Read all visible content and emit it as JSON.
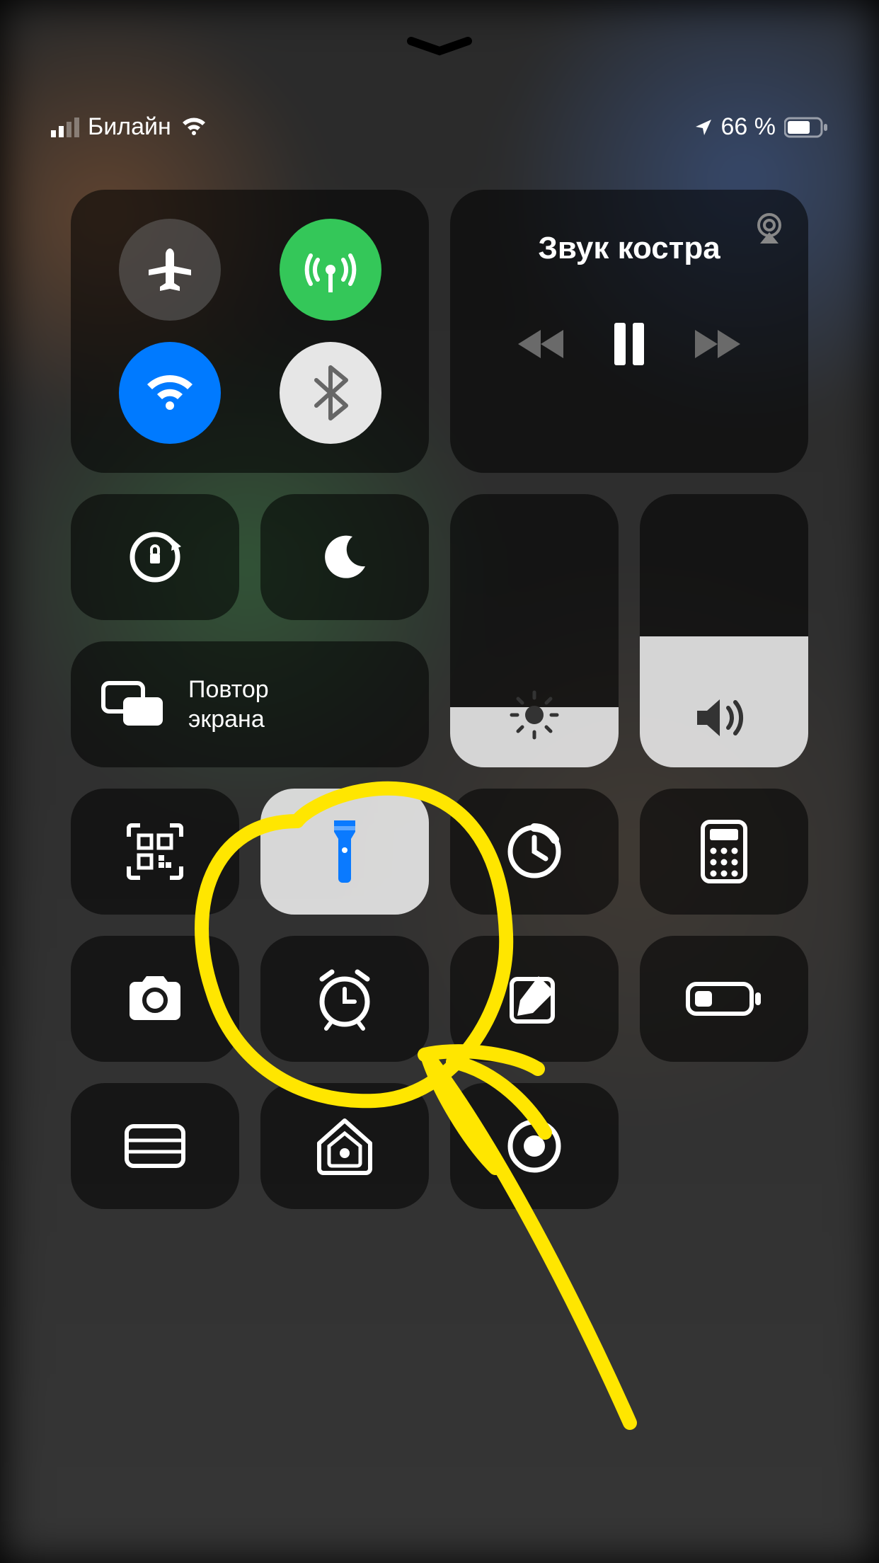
{
  "status": {
    "carrier": "Билайн",
    "battery_text": "66 %"
  },
  "media": {
    "now_playing": "Звук костра"
  },
  "mirror": {
    "label_line1": "Повтор",
    "label_line2": "экрана"
  },
  "sliders": {
    "brightness_pct": 22,
    "volume_pct": 48
  },
  "toggles": {
    "airplane": false,
    "cellular": true,
    "wifi": true,
    "bluetooth": true,
    "orientation_lock": false,
    "dnd": false,
    "flashlight": true
  },
  "colors": {
    "green": "#34c759",
    "blue": "#007aff",
    "tile_on": "rgba(230,230,230,.92)",
    "annotation": "#ffe600"
  }
}
